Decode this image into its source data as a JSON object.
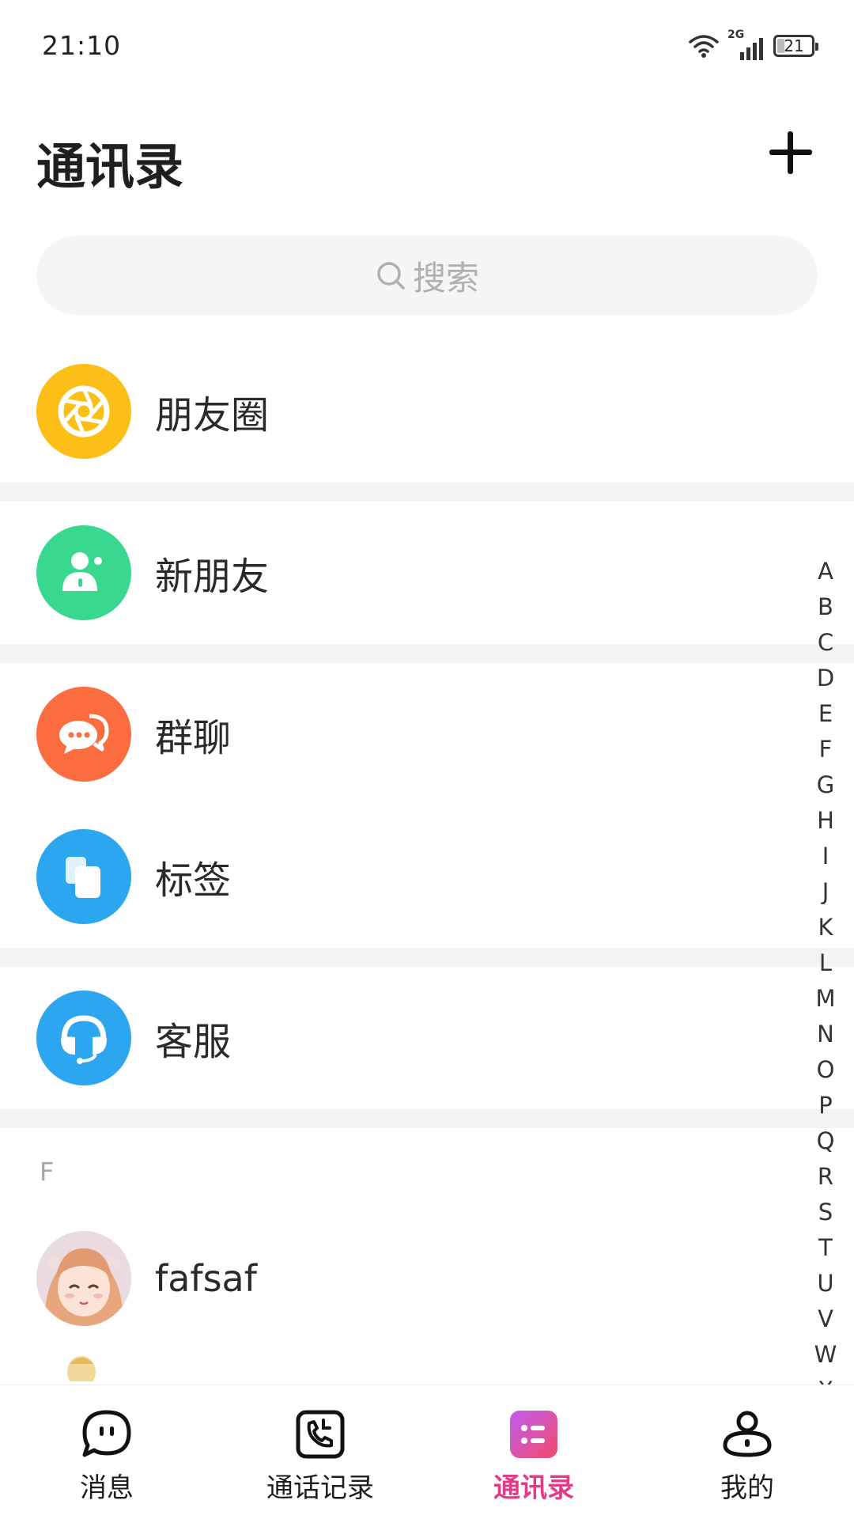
{
  "status_bar": {
    "time": "21:10",
    "network": "2G",
    "battery": "21",
    "battery_level": 0.21,
    "icons": [
      "wifi-icon",
      "signal-icon",
      "battery-icon"
    ]
  },
  "header": {
    "title": "通讯录",
    "add_icon": "plus-icon"
  },
  "search": {
    "placeholder": "搜索",
    "icon": "search-icon"
  },
  "entries": [
    {
      "label": "朋友圈",
      "icon": "aperture-icon",
      "color": "#FBBF18"
    },
    {
      "label": "新朋友",
      "icon": "new-friend-icon",
      "color": "#38D98F"
    },
    {
      "label": "群聊",
      "icon": "group-chat-icon",
      "color": "#FB6D3F"
    },
    {
      "label": "标签",
      "icon": "tag-icon",
      "color": "#2DA6F0"
    },
    {
      "label": "客服",
      "icon": "headset-icon",
      "color": "#2DA6F0"
    }
  ],
  "contacts": {
    "section_letter": "F",
    "items": [
      {
        "name": "fafsaf",
        "avatar": "anime-girl-avatar"
      }
    ]
  },
  "alphabet_index": [
    "A",
    "B",
    "C",
    "D",
    "E",
    "F",
    "G",
    "H",
    "I",
    "J",
    "K",
    "L",
    "M",
    "N",
    "O",
    "P",
    "Q",
    "R",
    "S",
    "T",
    "U",
    "V",
    "W",
    "X"
  ],
  "tab_bar": {
    "active_color": "#E03C8A",
    "tabs": [
      {
        "label": "消息",
        "icon": "message-icon"
      },
      {
        "label": "通话记录",
        "icon": "call-log-icon"
      },
      {
        "label": "通讯录",
        "icon": "contacts-icon",
        "active": true
      },
      {
        "label": "我的",
        "icon": "profile-icon"
      }
    ]
  }
}
